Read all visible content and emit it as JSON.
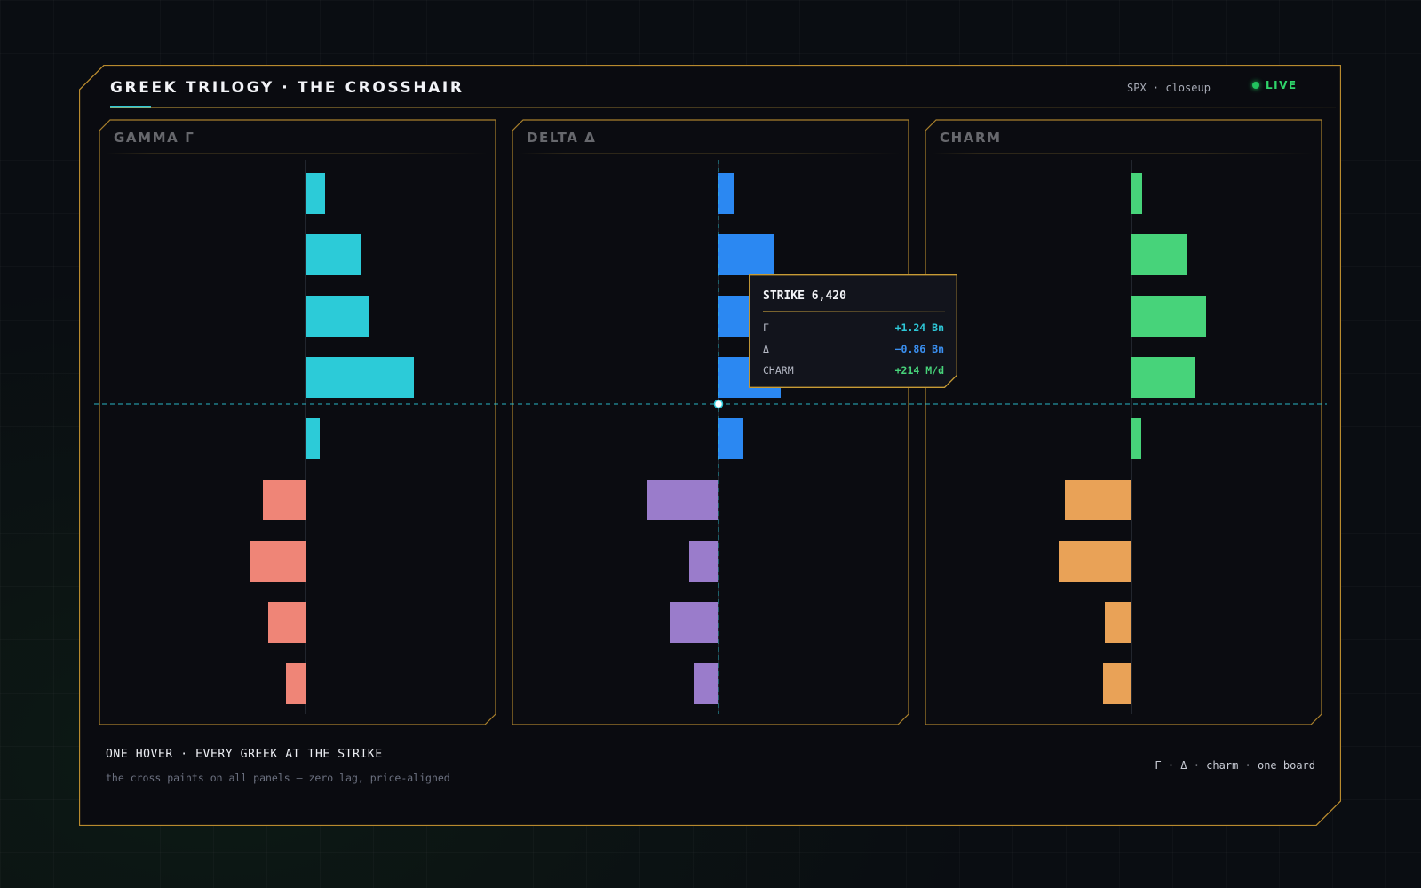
{
  "header": {
    "title": "GREEK TRILOGY · THE CROSSHAIR",
    "subtitle": "SPX · closeup",
    "live_label": "LIVE"
  },
  "colors": {
    "border": "#b88a2e",
    "crosshair": "#2ec8d8",
    "gamma_pos": "#2ccbd8",
    "gamma_neg": "#ef8577",
    "delta_pos": "#2b88f2",
    "delta_neg": "#9a7ccb",
    "charm_pos": "#47d37a",
    "charm_neg": "#e9a257"
  },
  "tooltip": {
    "title": "STRIKE 6,420",
    "rows": [
      {
        "label": "Γ",
        "value": "+1.24 Bn",
        "color": "#2ec8d8"
      },
      {
        "label": "Δ",
        "value": "−0.86 Bn",
        "color": "#3a8ff0"
      },
      {
        "label": "CHARM",
        "value": "+214 M/d",
        "color": "#47d37a"
      }
    ]
  },
  "footer": {
    "title": "ONE HOVER · EVERY GREEK AT THE STRIKE",
    "subtitle": "the cross paints on all panels — zero lag, price-aligned",
    "right": "Γ · Δ · charm · one board"
  },
  "chart_data": [
    {
      "type": "bar",
      "orientation": "horizontal",
      "title": "GAMMA Γ",
      "values": [
        0.22,
        0.62,
        0.72,
        1.22,
        0.16,
        -0.48,
        -0.62,
        -0.42,
        -0.22
      ],
      "colors": {
        "positive": "#2ccbd8",
        "negative": "#ef8577"
      }
    },
    {
      "type": "bar",
      "orientation": "horizontal",
      "title": "DELTA Δ",
      "values": [
        0.17,
        0.62,
        0.7,
        0.7,
        0.28,
        -0.8,
        -0.33,
        -0.55,
        -0.28
      ],
      "colors": {
        "positive": "#2b88f2",
        "negative": "#9a7ccb"
      }
    },
    {
      "type": "bar",
      "orientation": "horizontal",
      "title": "CHARM",
      "values": [
        0.12,
        0.62,
        0.84,
        0.72,
        0.11,
        -0.75,
        -0.82,
        -0.3,
        -0.32
      ],
      "colors": {
        "positive": "#47d37a",
        "negative": "#e9a257"
      }
    }
  ]
}
